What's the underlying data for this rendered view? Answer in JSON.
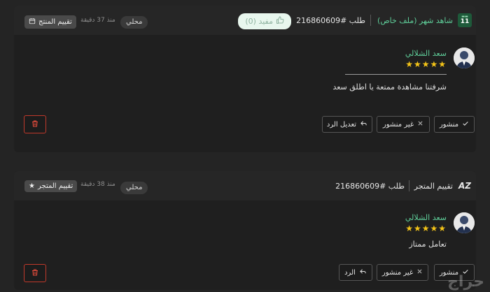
{
  "review1": {
    "source_title": "شاهد شهر (ملف خاص)",
    "order_label": "طلب #216860609",
    "helpful_label": "مفيد (0)",
    "type_label": "تقييم المنتج",
    "time_ago": "منذ 37 دقيقة",
    "locale_badge": "محلي",
    "reviewer_name": "سعد الشلالي",
    "stars": "★★★★★",
    "rating": 5,
    "comment": "شرفتنا مشاهدة ممتعة يا اطلق سعد",
    "buttons": {
      "published": "منشور",
      "unpublished": "غير منشور",
      "edit_reply": "تعديل الرد"
    }
  },
  "review2": {
    "source_title": "تقييم المتجر",
    "order_label": "طلب #216860609",
    "type_label": "تقييم المتجر",
    "time_ago": "منذ 38 دقيقة",
    "locale_badge": "محلي",
    "reviewer_name": "سعد الشلالي",
    "stars": "★★★★★",
    "rating": 5,
    "comment": "تعامل ممتاز",
    "buttons": {
      "published": "منشور",
      "unpublished": "غير منشور",
      "reply": "الرد"
    }
  },
  "logo_text": "AZ",
  "shahid_logo_number": "11",
  "watermark": "حراج",
  "colors": {
    "accent_green": "#5fcf9a",
    "star": "#f5c518",
    "danger": "#c0392b",
    "background": "#242424"
  }
}
